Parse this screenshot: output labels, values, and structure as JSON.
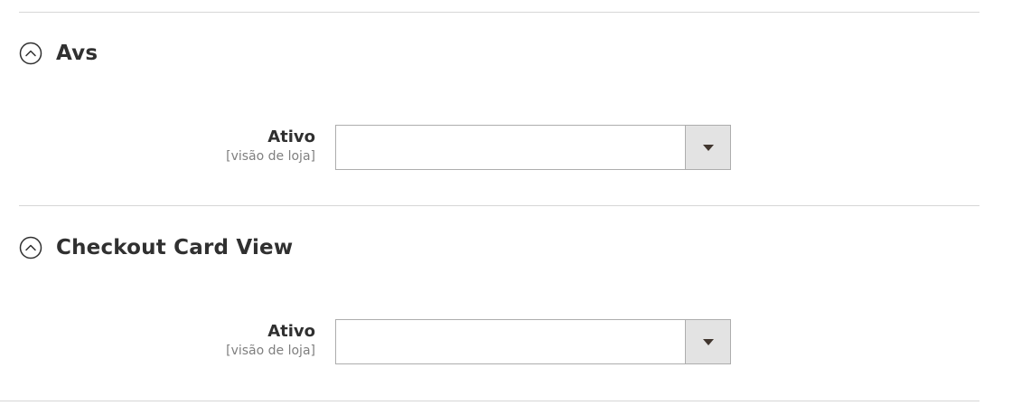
{
  "sections": [
    {
      "title": "Avs",
      "field": {
        "label": "Ativo",
        "scope": "[visão de loja]",
        "value": ""
      }
    },
    {
      "title": "Checkout Card View",
      "field": {
        "label": "Ativo",
        "scope": "[visão de loja]",
        "value": ""
      }
    }
  ],
  "icons": {
    "section_toggle": "collapse-circle-icon",
    "select_arrow": "chevron-down-icon"
  },
  "colors": {
    "divider": "#d6d6d6",
    "text": "#303030",
    "scope_text": "#7f7f7f",
    "select_border": "#adadad",
    "select_arrow_bg": "#e3e3e3"
  }
}
